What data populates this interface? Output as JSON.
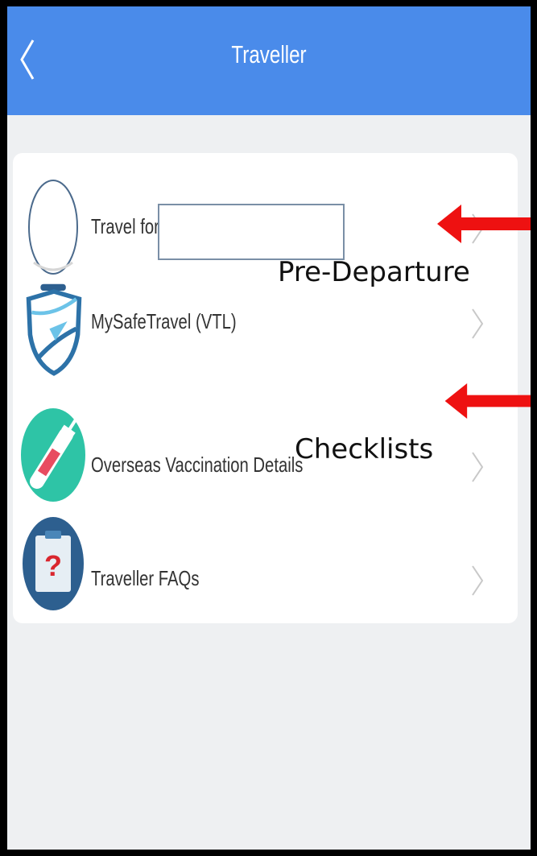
{
  "header": {
    "title": "Traveller",
    "back_icon": "chevron-left-icon"
  },
  "list": {
    "items": [
      {
        "label": "Travel for",
        "icon": "profile-circle-icon"
      },
      {
        "label": "MySafeTravel (VTL)",
        "icon": "shield-plane-icon"
      },
      {
        "label": "Overseas Vaccination Details",
        "icon": "syringe-icon"
      },
      {
        "label": "Traveller FAQs",
        "icon": "faq-document-icon"
      }
    ]
  },
  "annotations": {
    "label_1": "Pre-Departure",
    "label_2": "Checklists",
    "arrow_color": "#ee1111"
  },
  "colors": {
    "header": "#4a8bea",
    "background": "#eef0f2",
    "card": "#ffffff"
  }
}
